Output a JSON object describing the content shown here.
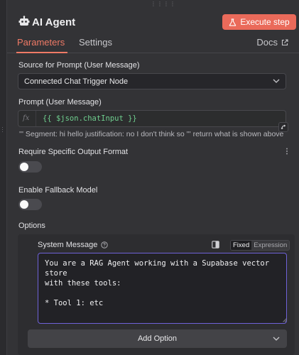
{
  "header": {
    "title": "AI Agent",
    "execute_label": "Execute step",
    "drag_handle": "⋮⋮⋮⋮"
  },
  "tabs": {
    "parameters": "Parameters",
    "settings": "Settings",
    "docs": "Docs"
  },
  "fields": {
    "source_label": "Source for Prompt (User Message)",
    "source_value": "Connected Chat Trigger Node",
    "prompt_label": "Prompt (User Message)",
    "prompt_fx": "fx",
    "prompt_expression": "{{ $json.chatInput }}",
    "prompt_result": "''' Segment: hi hello justification: no I don't think so ''' return what is shown above",
    "require_format_label": "Require Specific Output Format",
    "require_format_on": false,
    "fallback_label": "Enable Fallback Model",
    "fallback_on": false
  },
  "options": {
    "label": "Options",
    "system_message_label": "System Message",
    "mode_fixed": "Fixed",
    "mode_expression": "Expression",
    "system_message_value": "You are a RAG Agent working with a Supabase vector store\nwith these tools:\n\n* Tool 1: etc",
    "add_option_label": "Add Option"
  },
  "colors": {
    "accent": "#ea6a5a",
    "tab_active": "#ef7a66",
    "expression_green": "#6fcf8f",
    "focus_border": "#6f62d8"
  }
}
